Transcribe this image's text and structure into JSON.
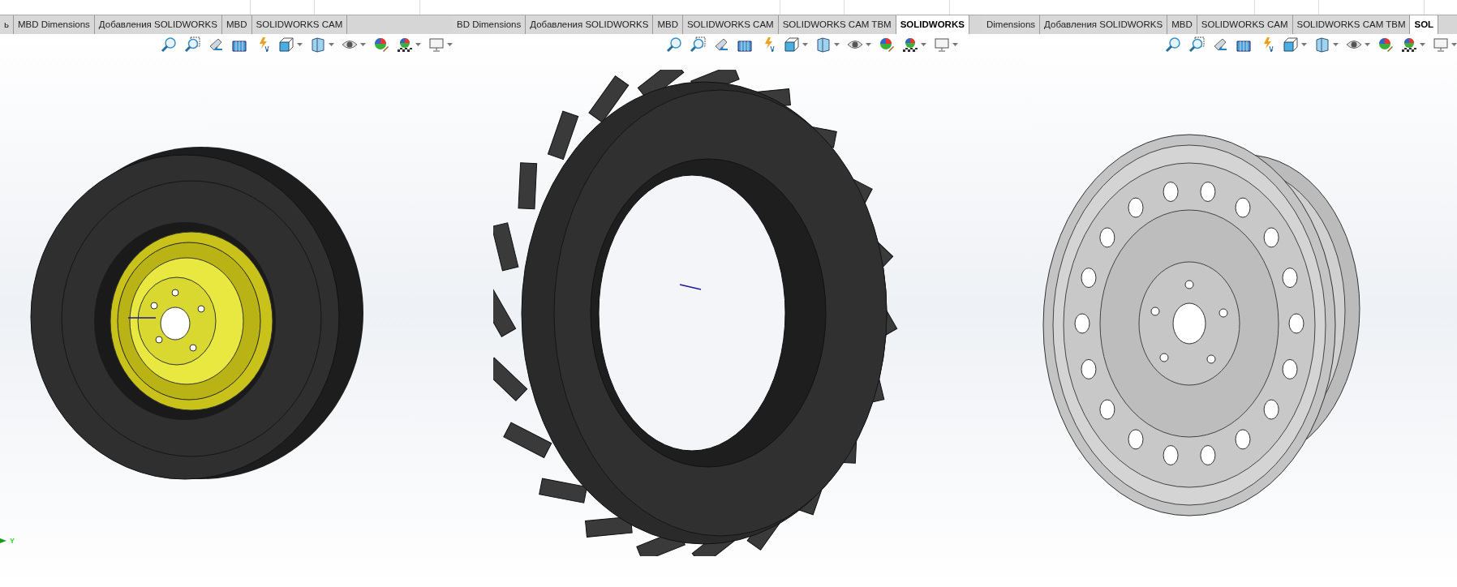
{
  "panels": [
    {
      "tabs": [
        {
          "label": "ь",
          "selected": false
        },
        {
          "label": "MBD Dimensions",
          "selected": false
        },
        {
          "label": "Добавления SOLIDWORKS",
          "selected": false
        },
        {
          "label": "MBD",
          "selected": false
        },
        {
          "label": "SOLIDWORKS CAM",
          "selected": false
        }
      ],
      "triad_label": "Y"
    },
    {
      "tabs": [
        {
          "label": "BD Dimensions",
          "selected": false
        },
        {
          "label": "Добавления SOLIDWORKS",
          "selected": false
        },
        {
          "label": "MBD",
          "selected": false
        },
        {
          "label": "SOLIDWORKS CAM",
          "selected": false
        },
        {
          "label": "SOLIDWORKS CAM TBM",
          "selected": false
        },
        {
          "label": "SOLIDWORKS",
          "selected": true
        }
      ]
    },
    {
      "tabs": [
        {
          "label": "Dimensions",
          "selected": false
        },
        {
          "label": "Добавления SOLIDWORKS",
          "selected": false
        },
        {
          "label": "MBD",
          "selected": false
        },
        {
          "label": "SOLIDWORKS CAM",
          "selected": false
        },
        {
          "label": "SOLIDWORKS CAM TBM",
          "selected": false
        },
        {
          "label": "SOL",
          "selected": true
        }
      ]
    }
  ]
}
